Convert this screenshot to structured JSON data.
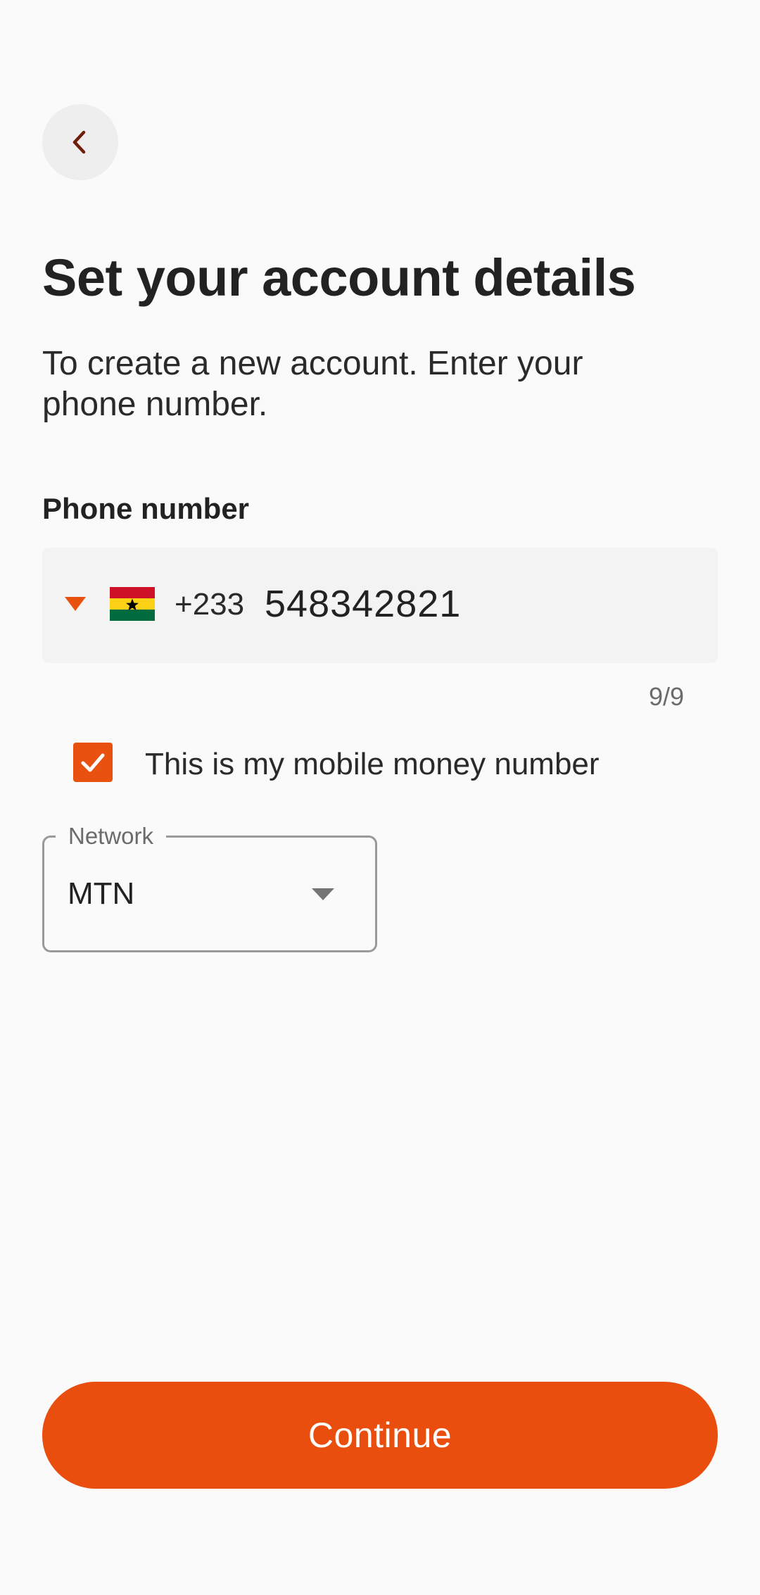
{
  "header": {
    "back_icon": "chevron-left-icon",
    "title": "Set your account details",
    "subtitle": "To create a new account. Enter your phone number."
  },
  "phone": {
    "label": "Phone number",
    "country_flag": "ghana-flag",
    "country_code": "+233",
    "value": "548342821",
    "counter": "9/9"
  },
  "mobile_money": {
    "checked": true,
    "label": "This is my mobile money number"
  },
  "network": {
    "label": "Network",
    "selected": "MTN"
  },
  "actions": {
    "continue_label": "Continue"
  },
  "colors": {
    "accent": "#E94E0F",
    "background": "#FAFAFA",
    "back_icon": "#6E1E0A"
  }
}
